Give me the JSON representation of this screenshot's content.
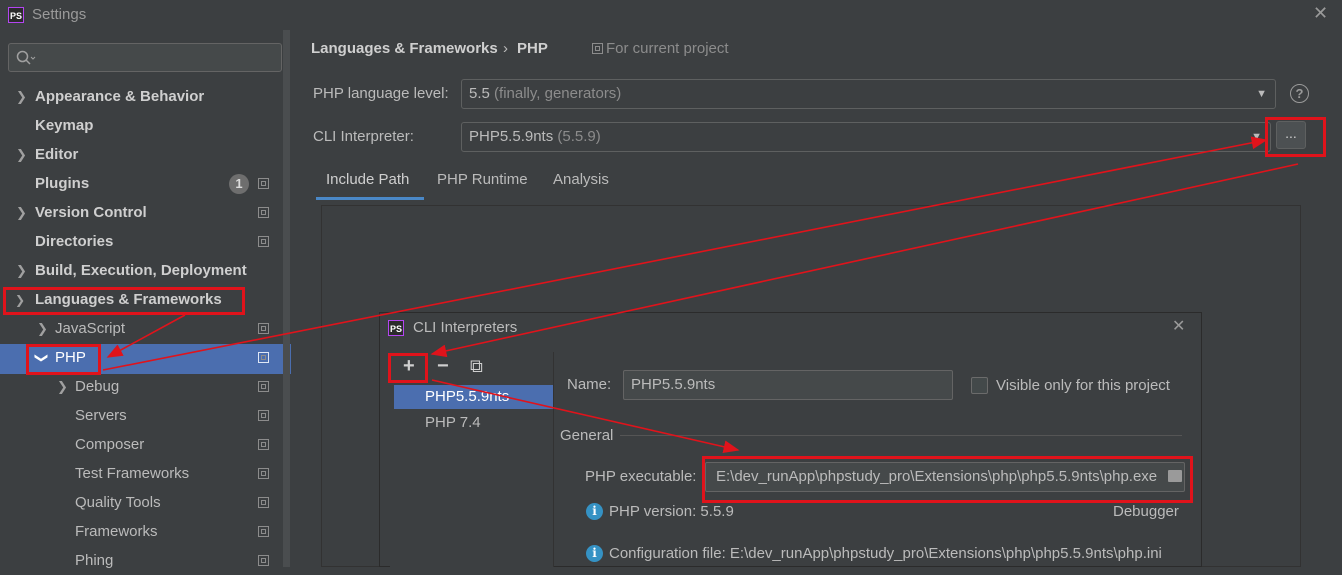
{
  "window": {
    "app_logo": "PS",
    "title": "Settings"
  },
  "sidebar": {
    "search": {
      "placeholder": ""
    },
    "items": [
      {
        "label": "Appearance & Behavior",
        "expandable": true,
        "bold": true
      },
      {
        "label": "Keymap",
        "expandable": false,
        "bold": true
      },
      {
        "label": "Editor",
        "expandable": true,
        "bold": true
      },
      {
        "label": "Plugins",
        "expandable": false,
        "bold": true,
        "badge": "1"
      },
      {
        "label": "Version Control",
        "expandable": true,
        "bold": true
      },
      {
        "label": "Directories",
        "expandable": false,
        "bold": true
      },
      {
        "label": "Build, Execution, Deployment",
        "expandable": true,
        "bold": true
      },
      {
        "label": "Languages & Frameworks",
        "expanded": true,
        "bold": true
      },
      {
        "label": "JavaScript",
        "expandable": true
      },
      {
        "label": "PHP",
        "expanded": true,
        "selected": true
      },
      {
        "label": "Debug",
        "expandable": true
      },
      {
        "label": "Servers"
      },
      {
        "label": "Composer"
      },
      {
        "label": "Test Frameworks"
      },
      {
        "label": "Quality Tools"
      },
      {
        "label": "Frameworks"
      },
      {
        "label": "Phing"
      }
    ]
  },
  "main": {
    "breadcrumb": {
      "parent": "Languages & Frameworks",
      "separator": "›",
      "current": "PHP"
    },
    "scope_note": "For current project",
    "language_level": {
      "label": "PHP language level:",
      "value": "5.5",
      "hint": "(finally, generators)"
    },
    "cli": {
      "label": "CLI Interpreter:",
      "value": "PHP5.5.9nts",
      "hint": "(5.5.9)",
      "browse_label": "..."
    },
    "tabs": [
      {
        "label": "Include Path",
        "active": true
      },
      {
        "label": "PHP Runtime"
      },
      {
        "label": "Analysis"
      }
    ]
  },
  "dialog": {
    "logo": "PS",
    "title": "CLI Interpreters",
    "toolbar": {
      "add": "+",
      "remove": "−",
      "copy": "⧉"
    },
    "interpreters": [
      {
        "label": "PHP5.5.9nts",
        "selected": true
      },
      {
        "label": "PHP 7.4"
      }
    ],
    "name_label": "Name:",
    "name_value": "PHP5.5.9nts",
    "visible_only_label": "Visible only for this project",
    "section_general": "General",
    "executable_label": "PHP executable:",
    "executable_value": "E:\\dev_runApp\\phpstudy_pro\\Extensions\\php\\php5.5.9nts\\php.exe",
    "version_text": "PHP version: 5.5.9",
    "debugger_label": "Debugger",
    "config_text": "Configuration file: E:\\dev_runApp\\phpstudy_pro\\Extensions\\php\\php5.5.9nts\\php.ini"
  },
  "colors": {
    "annotation": "#e0131b",
    "selection": "#4b6eaf",
    "tab_underline": "#4a88c7",
    "info": "#3592c4"
  },
  "icons": [
    "search-icon",
    "chevron-right-icon",
    "chevron-down-icon",
    "project-scope-icon",
    "help-icon",
    "close-icon",
    "folder-icon",
    "info-icon"
  ]
}
